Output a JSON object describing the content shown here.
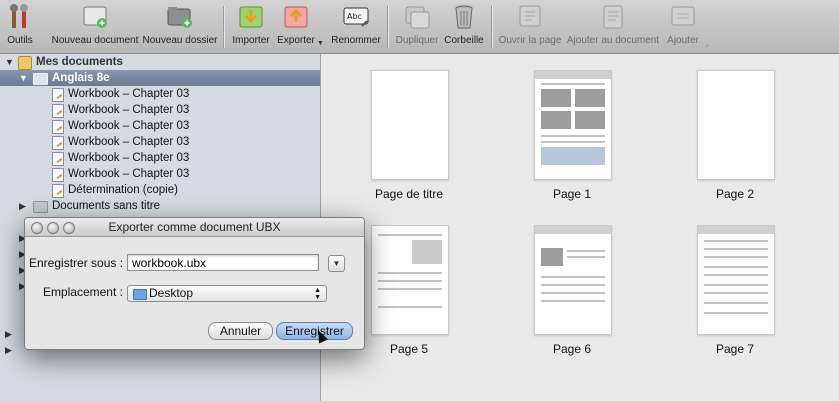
{
  "toolbar": {
    "items": [
      {
        "label": "Outils",
        "icon": "tools-icon",
        "disabled": false
      },
      {
        "label": "Nouveau document",
        "icon": "new-document-icon",
        "disabled": false
      },
      {
        "label": "Nouveau dossier",
        "icon": "new-folder-icon",
        "disabled": false
      },
      {
        "label": "Importer",
        "icon": "import-icon",
        "disabled": false
      },
      {
        "label": "Exporter",
        "icon": "export-icon",
        "disabled": false
      },
      {
        "label": "Renommer",
        "icon": "rename-icon",
        "disabled": false
      },
      {
        "label": "Dupliquer",
        "icon": "duplicate-icon",
        "disabled": true
      },
      {
        "label": "Corbeille",
        "icon": "trash-icon",
        "disabled": false
      },
      {
        "label": "Ouvrir la page",
        "icon": "open-page-icon",
        "disabled": true
      },
      {
        "label": "Ajouter au document",
        "icon": "add-to-document-icon",
        "disabled": true
      },
      {
        "label": "Ajouter",
        "icon": "add-icon",
        "disabled": true
      }
    ]
  },
  "sidebar": {
    "root": "Mes documents",
    "selected_folder": "Anglais 8e",
    "documents": [
      "Workbook – Chapter 03",
      "Workbook – Chapter 03",
      "Workbook – Chapter 03",
      "Workbook – Chapter 03",
      "Workbook – Chapter 03",
      "Workbook – Chapter 03",
      "Détermination (copie)"
    ],
    "other_folder": "Documents sans titre"
  },
  "pages": [
    {
      "label": "Page de titre",
      "blank": true
    },
    {
      "label": "Page 1",
      "blank": false
    },
    {
      "label": "Page 2",
      "blank": true
    },
    {
      "label": "Page 5",
      "blank": false
    },
    {
      "label": "Page 6",
      "blank": false
    },
    {
      "label": "Page 7",
      "blank": false
    }
  ],
  "dialog": {
    "title": "Exporter comme document UBX",
    "save_as_label": "Enregistrer sous :",
    "filename": "workbook.ubx",
    "location_label": "Emplacement :",
    "location": "Desktop",
    "cancel": "Annuler",
    "save": "Enregistrer"
  },
  "colors": {
    "sidebar_bg": "#d5dbe4",
    "selection": "#7282a0",
    "default_button": "#8eb4e6"
  }
}
